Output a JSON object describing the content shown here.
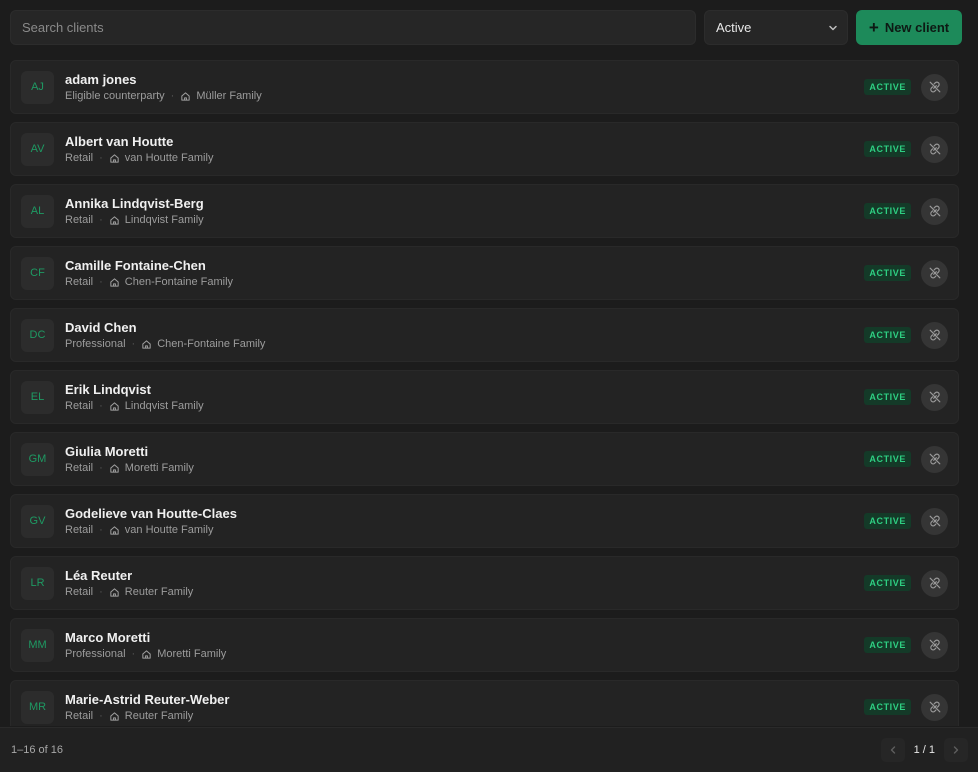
{
  "search": {
    "placeholder": "Search clients",
    "value": ""
  },
  "filter": {
    "selected": "Active"
  },
  "new_client_label": "New client",
  "clients": [
    {
      "initials": "AJ",
      "name": "adam jones",
      "category": "Eligible counterparty",
      "family": "Müller Family",
      "status": "ACTIVE"
    },
    {
      "initials": "AV",
      "name": "Albert van Houtte",
      "category": "Retail",
      "family": "van Houtte Family",
      "status": "ACTIVE"
    },
    {
      "initials": "AL",
      "name": "Annika Lindqvist-Berg",
      "category": "Retail",
      "family": "Lindqvist Family",
      "status": "ACTIVE"
    },
    {
      "initials": "CF",
      "name": "Camille Fontaine-Chen",
      "category": "Retail",
      "family": "Chen-Fontaine Family",
      "status": "ACTIVE"
    },
    {
      "initials": "DC",
      "name": "David Chen",
      "category": "Professional",
      "family": "Chen-Fontaine Family",
      "status": "ACTIVE"
    },
    {
      "initials": "EL",
      "name": "Erik Lindqvist",
      "category": "Retail",
      "family": "Lindqvist Family",
      "status": "ACTIVE"
    },
    {
      "initials": "GM",
      "name": "Giulia Moretti",
      "category": "Retail",
      "family": "Moretti Family",
      "status": "ACTIVE"
    },
    {
      "initials": "GV",
      "name": "Godelieve van Houtte-Claes",
      "category": "Retail",
      "family": "van Houtte Family",
      "status": "ACTIVE"
    },
    {
      "initials": "LR",
      "name": "Léa Reuter",
      "category": "Retail",
      "family": "Reuter Family",
      "status": "ACTIVE"
    },
    {
      "initials": "MM",
      "name": "Marco Moretti",
      "category": "Professional",
      "family": "Moretti Family",
      "status": "ACTIVE"
    },
    {
      "initials": "MR",
      "name": "Marie-Astrid Reuter-Weber",
      "category": "Retail",
      "family": "Reuter Family",
      "status": "ACTIVE"
    }
  ],
  "footer": {
    "count": "1–16 of 16",
    "page": "1 / 1"
  },
  "colors": {
    "accent": "#1d8a5a",
    "badge_text": "#2ecf82",
    "badge_bg": "#143a28",
    "background": "#1c1c1c"
  },
  "icons": {
    "row_action": "unlink-icon",
    "family": "home-icon",
    "filter": "chevron-down-icon",
    "add": "plus-icon"
  }
}
